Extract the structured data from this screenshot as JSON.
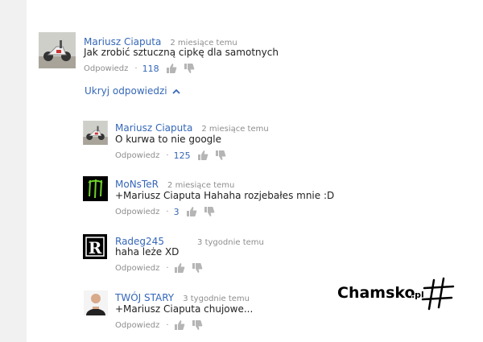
{
  "colors": {
    "link": "#3567b8",
    "muted": "#8e8e8e",
    "text": "#222222"
  },
  "top_comment": {
    "author": "Mariusz Ciaputa",
    "time": "2 miesiące temu",
    "text": "Jak zrobić sztuczną cipkę dla samotnych",
    "reply_label": "Odpowiedz",
    "likes": "118"
  },
  "hide_replies_label": "Ukryj odpowiedzi",
  "replies": [
    {
      "author": "Mariusz Ciaputa",
      "time": "2 miesiące temu",
      "text": "O kurwa to nie google",
      "reply_label": "Odpowiedz",
      "likes": "125"
    },
    {
      "author": "MoNsTeR",
      "time": "2 miesiące temu",
      "text": "+Mariusz Ciaputa Hahaha rozjebałes mnie :D",
      "reply_label": "Odpowiedz",
      "likes": "3"
    },
    {
      "author": "Radeg245",
      "time": "3 tygodnie temu",
      "text": "haha leże XD",
      "reply_label": "Odpowiedz",
      "likes": ""
    },
    {
      "author": "TWÓJ STARY",
      "time": "3 tygodnie temu",
      "text": "+Mariusz Ciaputa chujowe...",
      "reply_label": "Odpowiedz",
      "likes": ""
    }
  ],
  "watermark": {
    "brand": "Chamsko",
    "tld": ".pl"
  }
}
